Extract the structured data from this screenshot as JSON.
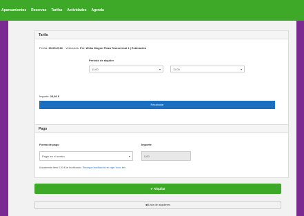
{
  "nav": {
    "items": [
      "Aparcamientos",
      "Reservas",
      "Tarifas",
      "Actividades",
      "Agenda"
    ]
  },
  "tarifa": {
    "title": "Tarifa",
    "fecha_label": "Fecha:",
    "fecha_value": "30-05-2016",
    "vehiculo_label": "Vehículo/s:",
    "vehiculo_value": "Pre. Webs Mogon Plaza Transversal 1 | Estimación",
    "periodo_label": "Período de alquiler",
    "from_value": "11:00",
    "to_value": "11:00",
    "importe_label": "Importe:",
    "importe_value": "23,80 €",
    "button": "Recalcular"
  },
  "pago": {
    "title": "Pago",
    "forma_label": "Forma de pago",
    "forma_value": "Pagar en el centro",
    "importe_label": "Importe",
    "importe_value": "0,00",
    "note_prefix": "Actualmente tiene 0,00 € de bonificación.",
    "note_link": "Recargue bonificación en caja / bono info"
  },
  "actions": {
    "confirm": "✔ Alquilar",
    "back": "◀ Lista de alquileres"
  },
  "colors": {
    "nav": "#3ea829",
    "frame": "#7b2a91",
    "primary": "#1a6fc1"
  }
}
